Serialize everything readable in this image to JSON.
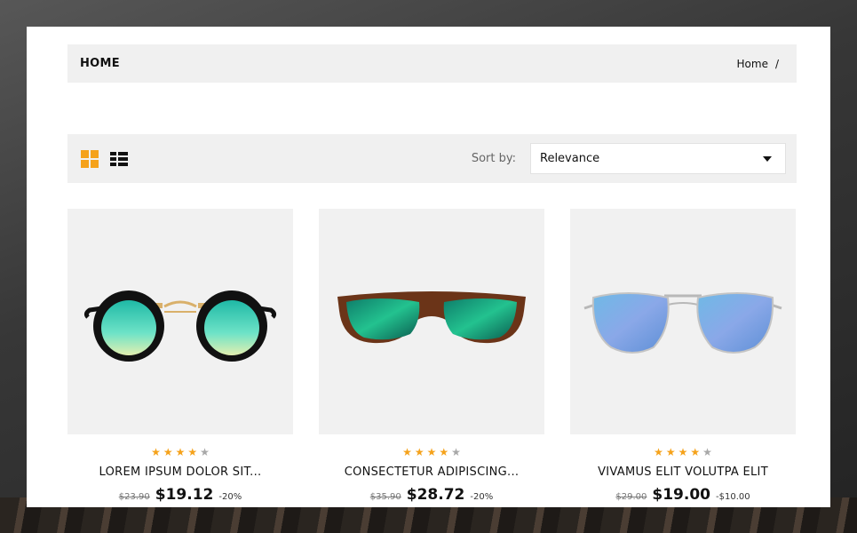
{
  "breadcrumb": {
    "page_title": "HOME",
    "items": [
      {
        "label": "Home"
      }
    ],
    "separator": "/"
  },
  "toolbar": {
    "sort_label": "Sort by:",
    "sort_value": "Relevance",
    "grid_view_icon": "grid-icon",
    "list_view_icon": "list-icon"
  },
  "colors": {
    "accent": "#f5a21b",
    "star_off": "#a8a8a8"
  },
  "products": [
    {
      "name": "LOREM IPSUM DOLOR SIT...",
      "rating": 4,
      "max_rating": 5,
      "old_price": "$23.90",
      "price": "$19.12",
      "discount": "-20%"
    },
    {
      "name": "CONSECTETUR ADIPISCING...",
      "rating": 4,
      "max_rating": 5,
      "old_price": "$35.90",
      "price": "$28.72",
      "discount": "-20%"
    },
    {
      "name": "VIVAMUS ELIT VOLUTPA ELIT",
      "rating": 4,
      "max_rating": 5,
      "old_price": "$29.00",
      "price": "$19.00",
      "discount": "-$10.00"
    }
  ]
}
